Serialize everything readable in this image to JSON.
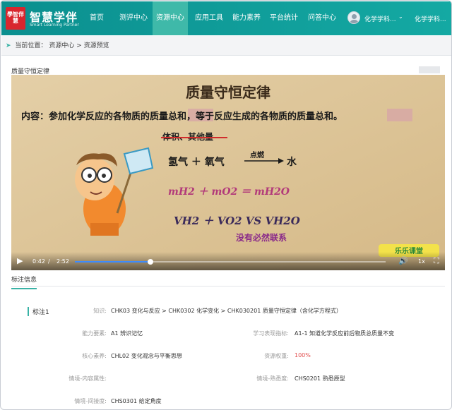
{
  "header": {
    "logo_text": "學智伴慧",
    "brand": "智慧学伴",
    "brand_sub": "Smart Learning Partner",
    "nav": [
      "首页",
      "测评中心",
      "资源中心",
      "应用工具",
      "能力素养",
      "平台统计",
      "问答中心"
    ],
    "active_nav": "资源中心",
    "user": "化学学科...",
    "user2": "化学学科..."
  },
  "breadcrumb": {
    "prefix": "当前位置：",
    "path": "资源中心 > 资源预览"
  },
  "resource_title": "质量守恒定律",
  "video": {
    "slide_title": "质量守恒定律",
    "content_line": "内容：参加化学反应的各物质的质量总和，等于反应生成的各物质的质量总和。",
    "struck_text": "体积、其他量",
    "eq_left": "氢气 ＋ 氧气",
    "eq_condition": "点燃",
    "eq_right": "水",
    "mass_eq": "mH2 ＋ mO2 ＝ mH2O",
    "vol_eq": "VH2 ＋ VO2  VS  VH2O",
    "no_relation": "没有必然联系",
    "watermark": "乐乐课堂",
    "current_time": "0:42",
    "separator": "/",
    "duration": "2:52",
    "progress": 0.2442,
    "speed": "1x"
  },
  "tab_label": "标注信息",
  "annotation": {
    "tag": "标注1",
    "knowledge_label": "知识:",
    "knowledge_value": "CHK03 变化与反应 > CHK0302 化学变化 > CHK030201 质量守恒定律（含化学方程式）",
    "ability_label": "能力要素:",
    "ability_value": "A1 辨识记忆",
    "performance_label": "学习表现指标:",
    "performance_value": "A1-1 知道化学反应前后物质总质量不变",
    "core_label": "核心素养:",
    "core_value": "CHL02 变化观念与平衡思想",
    "weight_label": "资源权重:",
    "weight_value": "100%",
    "context_attr_label": "情境-内容属性:",
    "familiarity_label": "情境-熟悉度:",
    "familiarity_value": "CHS0201 熟悉原型",
    "perspective_label": "情境-间接度:",
    "perspective_value": "CHS0301 给定角度"
  }
}
